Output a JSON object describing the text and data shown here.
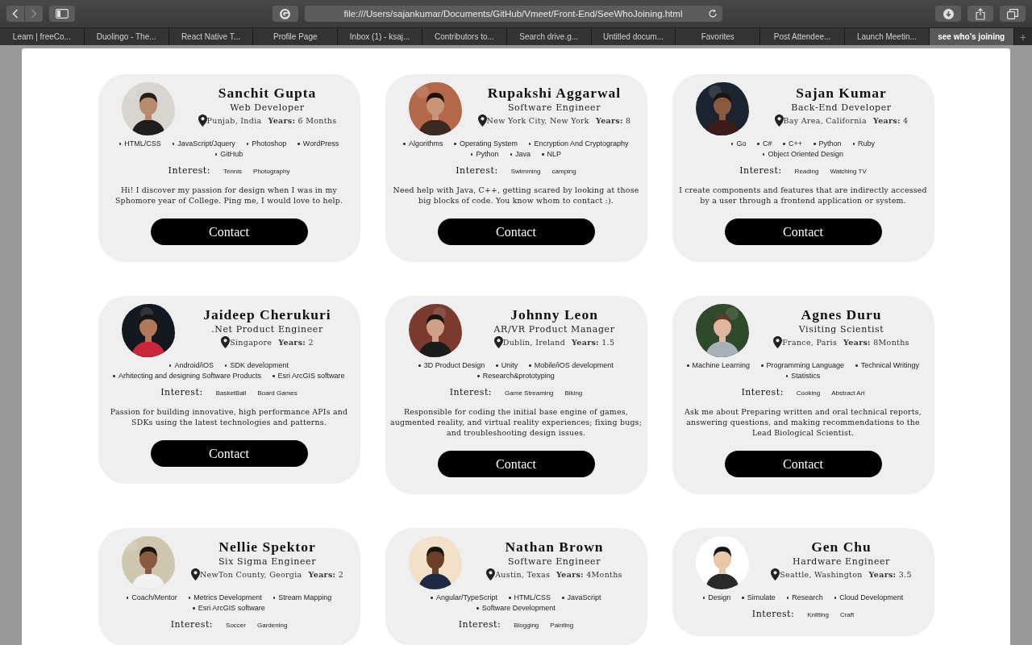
{
  "browser": {
    "url": "file:///Users/sajankumar/Documents/GitHub/Vmeet/Front-End/SeeWhoJoining.html",
    "tabs": [
      {
        "label": "Learn | freeCo...",
        "selected": false
      },
      {
        "label": "Duolingo - The...",
        "selected": false
      },
      {
        "label": "React Native T...",
        "selected": false
      },
      {
        "label": "Profile Page",
        "selected": false
      },
      {
        "label": "Inbox (1) - ksaj...",
        "selected": false
      },
      {
        "label": "Contributors to...",
        "selected": false
      },
      {
        "label": "Search drive.g...",
        "selected": false
      },
      {
        "label": "Untitled docum...",
        "selected": false
      },
      {
        "label": "Favorites",
        "selected": false
      },
      {
        "label": "Post Attendee...",
        "selected": false
      },
      {
        "label": "Launch Meetin...",
        "selected": false
      },
      {
        "label": "see who's joining",
        "selected": true
      }
    ],
    "new_tab": "+"
  },
  "people": [
    {
      "name": "Sanchit Gupta",
      "role": "Web Developer",
      "location": "Punjab, India",
      "years_label": "Years:",
      "years": "6 Months",
      "skills": [
        "HTML/CSS",
        "JavaScript/Jquery",
        "Photoshop",
        "WordPress",
        "GitHub"
      ],
      "interest_label": "Interest:",
      "interests": [
        "Tennis",
        "Photography"
      ],
      "bio": "Hi! I discover my passion for design when I was in my Sphomore year of College. Ping me, I would love to help.",
      "contact": "Contact"
    },
    {
      "name": "Rupakshi Aggarwal",
      "role": "Software Engineer",
      "location": "New York City, New York",
      "years_label": "Years:",
      "years": "8",
      "skills": [
        "Algorithms",
        "Operating System",
        "Encryption And Cryptography",
        "Python",
        "Java",
        "NLP"
      ],
      "interest_label": "Interest:",
      "interests": [
        "Swimming",
        "camping"
      ],
      "bio": "Need help with Java, C++, getting scared by looking at those big blocks of code. You know whom to contact :).",
      "contact": "Contact"
    },
    {
      "name": "Sajan Kumar",
      "role": "Back-End Developer",
      "location": "Bay Area, California",
      "years_label": "Years:",
      "years": "4",
      "skills": [
        "Go",
        "C#",
        "C++",
        "Python",
        "Ruby",
        "Object Oriented Design"
      ],
      "interest_label": "Interest:",
      "interests": [
        "Reading",
        "Watching TV"
      ],
      "bio": "I create components and features that are indirectly accessed by a user through a frontend application or system.",
      "contact": "Contact"
    },
    {
      "name": "Jaideep Cherukuri",
      "role": ".Net Product Engineer",
      "location": "Singapore",
      "years_label": "Years:",
      "years": "2",
      "skills": [
        "Android/iOS",
        "SDK development",
        "Arhitecting and designing Software Products",
        "Esri ArcGIS software"
      ],
      "interest_label": "Interest:",
      "interests": [
        "BasketBall",
        "Board Games"
      ],
      "bio": "Passion for building innovative, high performance APIs and SDKs using the latest technologies and patterns.",
      "contact": "Contact"
    },
    {
      "name": "Johnny Leon",
      "role": "AR/VR Product Manager",
      "location": "Dublin, Ireland",
      "years_label": "Years:",
      "years": "1.5",
      "skills": [
        "3D Product Design",
        "Unity",
        "Mobile/iOS development",
        "Research&prototyping"
      ],
      "interest_label": "Interest:",
      "interests": [
        "Game Streaming",
        "Biking"
      ],
      "bio": "Responsible for coding the initial base engine of games, augmented reality, and virtual reality experiences; fixing bugs; and troubleshooting design issues.",
      "contact": "Contact"
    },
    {
      "name": "Agnes Duru",
      "role": "Visiting Scientist",
      "location": "France, Paris",
      "years_label": "Years:",
      "years": "8Months",
      "skills": [
        "Machine Learning",
        "Programming Language",
        "Technical Writingy",
        "Statistics"
      ],
      "interest_label": "Interest:",
      "interests": [
        "Cooking",
        "Abstract Art"
      ],
      "bio": "Ask me about Preparing written and oral technical reports, answering questions, and making recommendations to the Lead Biological Scientist.",
      "contact": "Contact"
    },
    {
      "name": "Nellie Spektor",
      "role": "Six Sigma Engineer",
      "location": "NewTon County, Georgia",
      "years_label": "Years:",
      "years": "2",
      "skills": [
        "Coach/Mentor",
        "Metrics Development",
        "Stream Mapping",
        "Esri ArcGIS software"
      ],
      "interest_label": "Interest:",
      "interests": [
        "Soccer",
        "Gardening"
      ]
    },
    {
      "name": "Nathan Brown",
      "role": "Software Engineer",
      "location": "Austin, Texas",
      "years_label": "Years:",
      "years": "4Months",
      "skills": [
        "Angular/TypeScript",
        "HTML/CSS",
        "JavaScript",
        "Software Development"
      ],
      "interest_label": "Interest:",
      "interests": [
        "Blogging",
        "Painting"
      ]
    },
    {
      "name": "Gen Chu",
      "role": "Hardware Engineer",
      "location": "Seattle, Washington",
      "years_label": "Years:",
      "years": "3.5",
      "skills": [
        "Design",
        "Simulate",
        "Research",
        "Cloud Development"
      ],
      "interest_label": "Interest:",
      "interests": [
        "Knitting",
        "Craft"
      ]
    }
  ]
}
